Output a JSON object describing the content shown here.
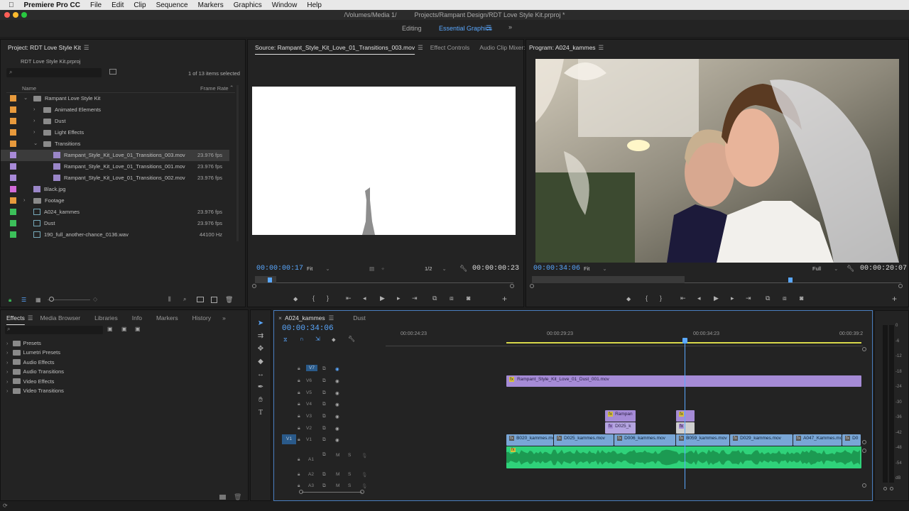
{
  "menubar": {
    "apple": "",
    "app_name": "Premiere Pro CC",
    "items": [
      "File",
      "Edit",
      "Clip",
      "Sequence",
      "Markers",
      "Graphics",
      "Window",
      "Help"
    ]
  },
  "titlebar": {
    "title": "/Volumes/Media 1/          Projects/Rampant Design/RDT Love Style Kit.prproj *"
  },
  "workspaces": {
    "editing": "Editing",
    "essential_graphics": "Essential Graphics",
    "more": "»"
  },
  "project": {
    "tab": "Project: RDT Love Style Kit",
    "file": "RDT Love Style Kit.prproj",
    "selection": "1 of 13 items selected",
    "col_name": "Name",
    "col_rate": "Frame Rate",
    "rows": [
      {
        "name": "Rampant Love Style Kit",
        "rate": "",
        "color": "#e89a3c",
        "indent": 0,
        "type": "folder",
        "twisty": "⌄"
      },
      {
        "name": "Animated Elements",
        "rate": "",
        "color": "#e89a3c",
        "indent": 1,
        "type": "folder",
        "twisty": "›"
      },
      {
        "name": "Dust",
        "rate": "",
        "color": "#e89a3c",
        "indent": 1,
        "type": "folder",
        "twisty": "›"
      },
      {
        "name": "Light Effects",
        "rate": "",
        "color": "#e89a3c",
        "indent": 1,
        "type": "folder",
        "twisty": "›"
      },
      {
        "name": "Transitions",
        "rate": "",
        "color": "#e89a3c",
        "indent": 1,
        "type": "folder",
        "twisty": "⌄"
      },
      {
        "name": "Rampant_Style_Kit_Love_01_Transitions_003.mov",
        "rate": "23.976 fps",
        "color": "#a88ad8",
        "indent": 2,
        "type": "clip",
        "twisty": ""
      },
      {
        "name": "Rampant_Style_Kit_Love_01_Transitions_001.mov",
        "rate": "23.976 fps",
        "color": "#a88ad8",
        "indent": 2,
        "type": "clip",
        "twisty": ""
      },
      {
        "name": "Rampant_Style_Kit_Love_01_Transitions_002.mov",
        "rate": "23.976 fps",
        "color": "#a88ad8",
        "indent": 2,
        "type": "clip",
        "twisty": ""
      },
      {
        "name": "Black.jpg",
        "rate": "",
        "color": "#d26ad8",
        "indent": 0,
        "type": "clip",
        "twisty": ""
      },
      {
        "name": "Footage",
        "rate": "",
        "color": "#e89a3c",
        "indent": 0,
        "type": "folder",
        "twisty": "›"
      },
      {
        "name": "A024_kammes",
        "rate": "23.976 fps",
        "color": "#3cc05a",
        "indent": 0,
        "type": "seq",
        "twisty": ""
      },
      {
        "name": "Dust",
        "rate": "23.976 fps",
        "color": "#3cc05a",
        "indent": 0,
        "type": "seq",
        "twisty": ""
      },
      {
        "name": "190_full_another-chance_0136.wav",
        "rate": "44100 Hz",
        "color": "#3cc05a",
        "indent": 0,
        "type": "seq",
        "twisty": ""
      }
    ]
  },
  "source": {
    "tab": "Source: Rampant_Style_Kit_Love_01_Transitions_003.mov",
    "tab2": "Effect Controls",
    "tab3": "Audio Clip Mixer: A",
    "more": "»",
    "timecode": "00:00:00:17",
    "fit": "Fit",
    "res": "1/2",
    "duration": "00:00:00:23"
  },
  "program": {
    "tab": "Program: A024_kammes",
    "timecode": "00:00:34:06",
    "fit": "Fit",
    "res": "Full",
    "duration": "00:00:20:07"
  },
  "effects": {
    "tabs": [
      "Effects",
      "Media Browser",
      "Libraries",
      "Info",
      "Markers",
      "History"
    ],
    "more": "»",
    "items": [
      "Presets",
      "Lumetri Presets",
      "Audio Effects",
      "Audio Transitions",
      "Video Effects",
      "Video Transitions"
    ]
  },
  "timeline": {
    "tab": "A024_kammes",
    "tab2": "Dust",
    "timecode": "00:00:34:06",
    "ruler": [
      "00:00:24:23",
      "00:00:29:23",
      "00:00:34:23",
      "00:00:39:2"
    ],
    "tracks_video": [
      "V7",
      "V6",
      "V5",
      "V4",
      "V3",
      "V2",
      "V1"
    ],
    "tracks_audio": [
      "A1",
      "A2",
      "A3"
    ],
    "source_patch_v": "V1",
    "mute": "M",
    "solo": "S",
    "clips": {
      "v6": "Rampant_Style_Kit_Love_01_Dust_001.mov",
      "v3a": "Rampan",
      "v3b": "",
      "v2a": "D025_k",
      "v2b": "",
      "v1": [
        "B020_kammes.mov",
        "D025_kammes.mov",
        "D006_kammes.mov",
        "B059_kammes.mov",
        "D029_kammes.mov",
        "A047_Kammes.mo",
        "D0"
      ]
    },
    "meter": [
      "0",
      "-6",
      "-12",
      "-18",
      "-24",
      "-30",
      "-36",
      "-42",
      "-48",
      "-54",
      "dB"
    ]
  },
  "colors": {
    "accent": "#5aa8ff",
    "purple": "#a58bd6",
    "blue": "#79a6d6",
    "green": "#2fd27a"
  }
}
